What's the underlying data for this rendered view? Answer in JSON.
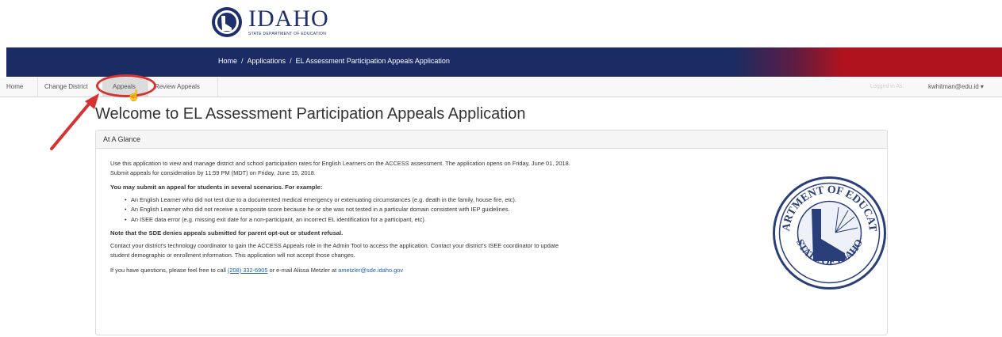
{
  "header": {
    "logo_name": "IDAHO",
    "logo_subtitle": "STATE DEPARTMENT OF EDUCATION"
  },
  "breadcrumb": {
    "home": "Home",
    "applications": "Applications",
    "current": "EL Assessment Participation Appeals Application",
    "separator": "/"
  },
  "nav": {
    "items": [
      {
        "label": "Home"
      },
      {
        "label": "Change District"
      },
      {
        "label": "Appeals"
      },
      {
        "label": "Review Appeals"
      }
    ],
    "logout": "Logged in As:",
    "user": "kwhitman@edu.id ▾"
  },
  "page": {
    "title": "Welcome to EL Assessment Participation Appeals Application"
  },
  "panel": {
    "heading": "At A Glance",
    "intro": "Use this application to view and manage district and school participation rates for English Learners on the ACCESS assessment. The application opens on Friday, June 01, 2018. Submit appeals for consideration by 11:59 PM (MDT) on Friday, June 15, 2018.",
    "scenarios_heading": "You may submit an appeal for students in several scenarios. For example:",
    "scenarios": [
      "An English Learner who did not test due to a documented medical emergency or extenuating circumstances (e.g. death in the family, house fire, etc).",
      "An English Learner who did not receive a composite score because he or she was not tested in a particular domain consistent with IEP guidelines.",
      "An ISEE data error (e.g. missing exit date for a non-participant, an incorrect EL identification for a participant, etc)."
    ],
    "note": "Note that the SDE denies appeals submitted for parent opt-out or student refusal.",
    "contact": "Contact your district's technology coordinator to gain the ACCESS Appeals role in the Admin Tool to access the application. Contact your district's ISEE coordinator to update student demographic or enrollment information. This application will not accept those changes.",
    "questions_prefix": "If you have questions, please feel free to call",
    "phone": "(208) 332-6905",
    "questions_middle": "or e-mail Alissa Metzler at",
    "email": "ametzler@sde.idaho.gov"
  },
  "seal": {
    "text_top": "DEPARTMENT OF EDUCATION",
    "text_bottom": "STATE OF IDAHO"
  },
  "colors": {
    "banner_blue": "#1b2b63",
    "banner_red": "#b0131e",
    "annotation_red": "#d63232",
    "link_blue": "#1a5fb4"
  }
}
